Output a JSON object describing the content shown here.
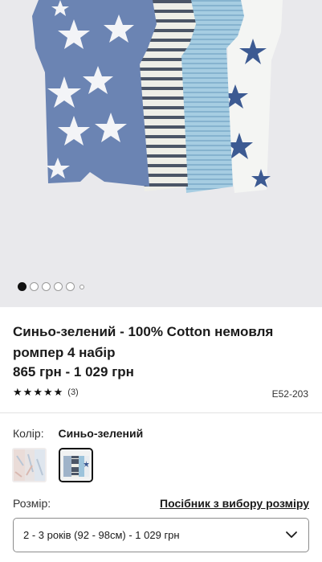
{
  "carousel": {
    "slide_count": 6,
    "active_index": 0
  },
  "product": {
    "title": "Синьо-зелений - 100% Cotton немовля ромпер 4 набір",
    "price": "865 грн - 1 029 грн",
    "rating": 5,
    "review_count": "(3)",
    "code": "E52-203"
  },
  "color": {
    "label": "Колір:",
    "selected": "Синьо-зелений",
    "swatches": [
      "pastel-set",
      "blue-green-set"
    ]
  },
  "size": {
    "label": "Розмір:",
    "guide_link": "Посібник з вибору розміру",
    "selected": "2 - 3 років (92 - 98см) - 1 029 грн"
  },
  "icons": {
    "rating": "star-icon",
    "dropdown": "chevron-down-icon"
  },
  "colors": {
    "text": "#1a1a1a",
    "hero_bg": "#e9e9ec",
    "romper_blue": "#6b84b3",
    "romper_light_blue": "#9cc3db",
    "star_navy": "#3c5a92"
  }
}
